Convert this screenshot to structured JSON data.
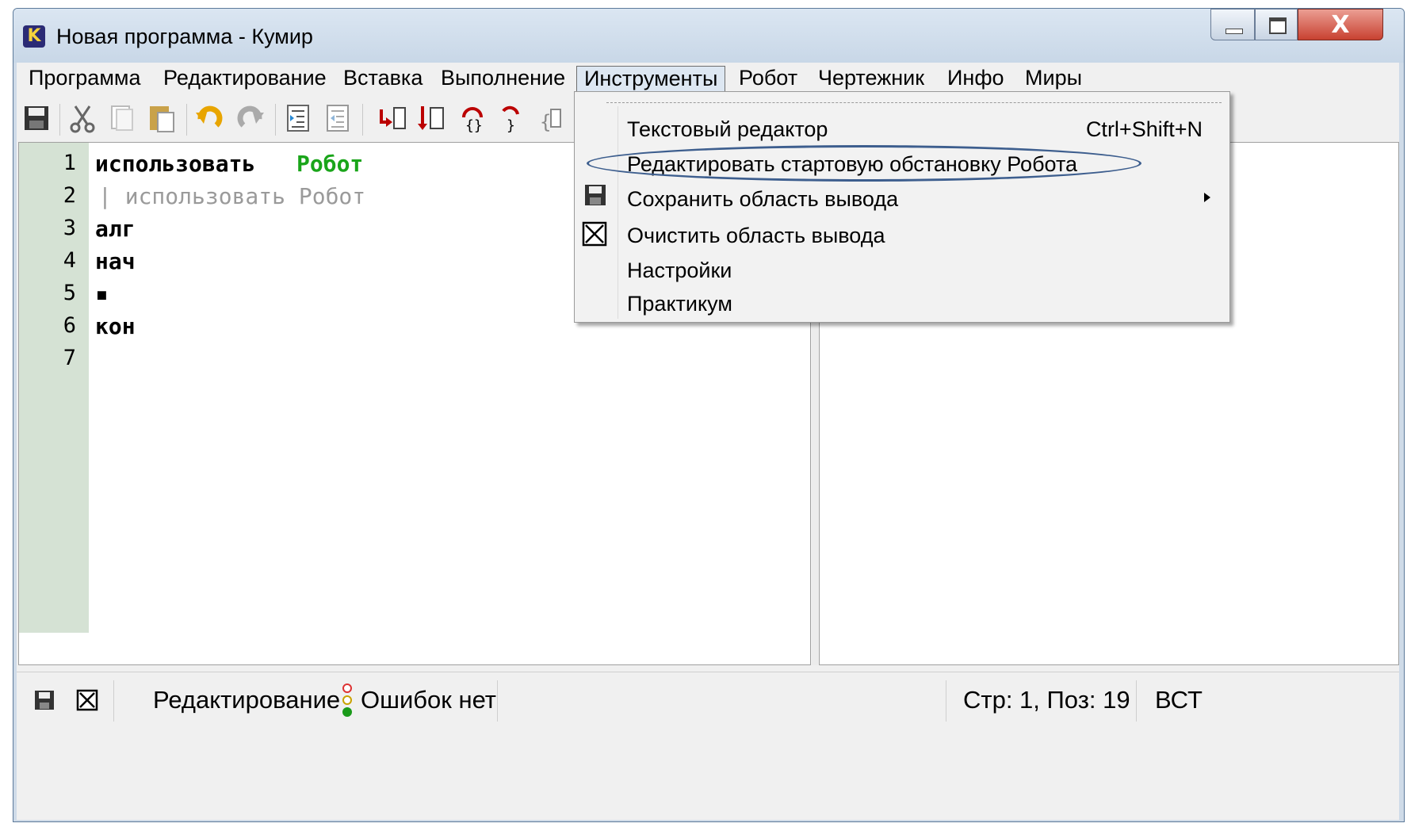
{
  "window": {
    "title": "Новая программа - Кумир",
    "app_icon_letter": "K",
    "close_glyph": "X"
  },
  "menu": {
    "items": [
      "Программа",
      "Редактирование",
      "Вставка",
      "Выполнение",
      "Инструменты",
      "Робот",
      "Чертежник",
      "Инфо",
      "Миры"
    ],
    "active": "Инструменты"
  },
  "toolbar": {
    "icons": [
      "save-icon",
      "cut-icon",
      "copy-icon",
      "paste-icon",
      "undo-icon",
      "redo-icon",
      "indent-icon",
      "unindent-icon",
      "step-into-icon",
      "step-over-icon",
      "run-icon",
      "step-icon",
      "step-out-icon"
    ]
  },
  "editor": {
    "line_numbers": [
      "1",
      "2",
      "3",
      "4",
      "5",
      "6",
      "7"
    ],
    "lines": [
      {
        "kw": "использовать",
        "name": "Робот"
      },
      {
        "comment": "| использовать Робот"
      },
      {
        "kw": "алг"
      },
      {
        "kw": "нач"
      },
      {
        "kw": "▪"
      },
      {
        "kw": "кон"
      },
      {
        "kw": ""
      }
    ]
  },
  "dropdown": {
    "items": [
      {
        "label": "Текстовый редактор",
        "shortcut": "Ctrl+Shift+N",
        "icon": ""
      },
      {
        "label": "Редактировать стартовую обстановку Робота",
        "shortcut": "",
        "icon": ""
      },
      {
        "label": "Сохранить область вывода",
        "shortcut": "",
        "icon": "save-icon",
        "submenu": true
      },
      {
        "label": "Очистить область вывода",
        "shortcut": "",
        "icon": "clear-icon"
      },
      {
        "label": "Настройки",
        "shortcut": "",
        "icon": ""
      },
      {
        "label": "Практикум",
        "shortcut": "",
        "icon": ""
      }
    ],
    "highlighted_item": "Редактировать стартовую обстановку Робота"
  },
  "status": {
    "mode": "Редактирование",
    "errors": "Ошибок нет",
    "position": "Стр: 1, Поз: 19",
    "insert_mode": "ВСТ"
  },
  "colors": {
    "gutter": "#d5e2d4",
    "keyword_green": "#1aa51a",
    "annotation_ellipse": "#3d5e8e"
  }
}
